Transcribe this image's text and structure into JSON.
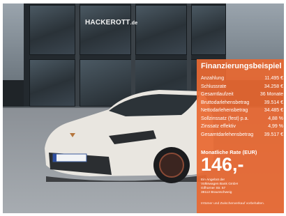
{
  "dealer": {
    "name": "HACKEROTT",
    "domain_suffix": ".de"
  },
  "car": {
    "plate_text": ""
  },
  "finance": {
    "title": "Finanzierungsbeispiel",
    "rows": [
      {
        "label": "Anzahlung",
        "value": "11.495 €"
      },
      {
        "label": "Schlussrate",
        "value": "34.258 €"
      },
      {
        "label": "Gesamtlaufzeit",
        "value": "36 Monate"
      },
      {
        "label": "Bruttodarlehensbetrag",
        "value": "39.514 €"
      },
      {
        "label": "Nettodarlehensbetrag",
        "value": "34.485 €"
      },
      {
        "label": "Sollzinssatz (fest) p.a.",
        "value": "4,88 %"
      },
      {
        "label": "Zinssatz effektiv",
        "value": "4,99 %"
      },
      {
        "label": "Gesamtdarlehensbetrag",
        "value": "39.517 €"
      }
    ],
    "rate_label": "Monatliche Rate (EUR)",
    "rate_value": "146,-",
    "provider_lines": [
      "Ein Angebot der",
      "Volkswagen Bank GmbH",
      "Gifhorner Str. 57",
      "38112 Braunschweig"
    ],
    "disclaimer": "Irrtümer und Zwischenverkauf vorbehalten."
  },
  "colors": {
    "panel": "#e86832",
    "car": "#e9e6e0"
  }
}
